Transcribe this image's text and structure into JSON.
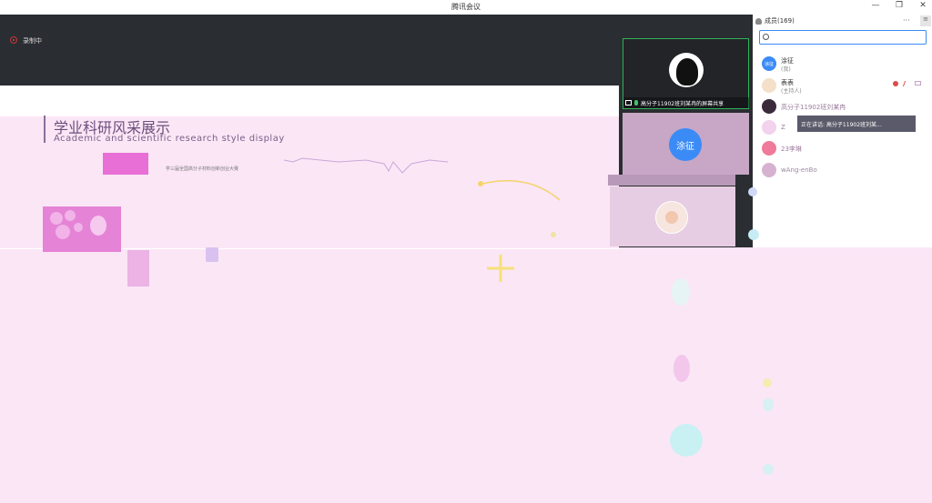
{
  "window": {
    "title": "腾讯会议",
    "controls": [
      "—",
      "❐",
      "✕"
    ]
  },
  "banner": {
    "recording_label": "录制中"
  },
  "slide": {
    "title": "学业科研风采展示",
    "subtitle": "Academic and scientific research style display",
    "caption": "学三届全国高分子材料创新创业大赛"
  },
  "video": {
    "tile1_name": "高分子11902班刘某冉的屏幕共享",
    "tile2_avatar_text": "涂征"
  },
  "members": {
    "title": "成员(169)",
    "more": "···",
    "search_value": "",
    "list": [
      {
        "name": "涂征",
        "sub": "(我)",
        "avatar_text": "涂征"
      },
      {
        "name": "表表",
        "sub": "(主持人)"
      },
      {
        "name": "高分子11902班刘某冉"
      },
      {
        "name": "Z"
      },
      {
        "name": "23李琳"
      },
      {
        "name": "wAng-enBo"
      }
    ],
    "tooltip": "正在讲话: 高分子11902班刘某..."
  },
  "colors": {
    "accent": "#3b8bf7",
    "speaking_green": "#2fb35a",
    "dark_bg": "#2a2d31",
    "pink_bg": "#fbe6f6"
  }
}
